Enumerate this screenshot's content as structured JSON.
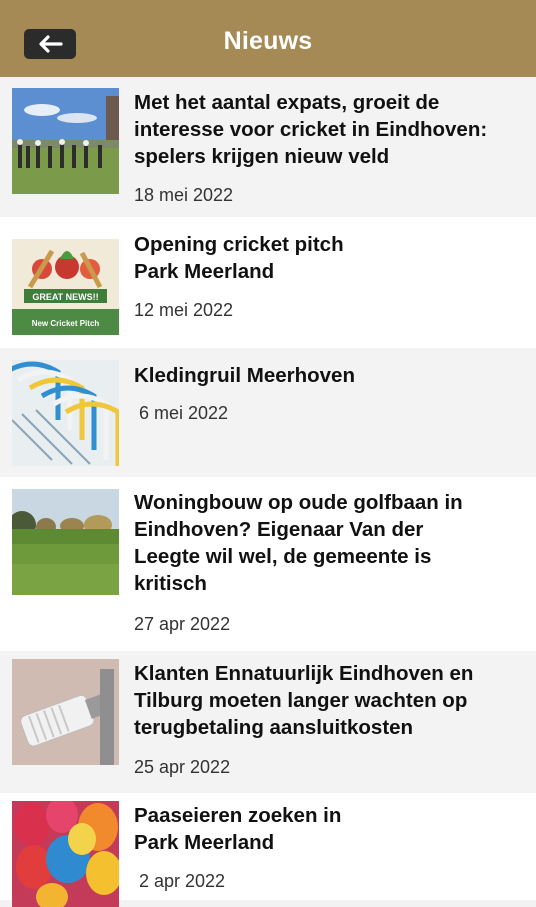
{
  "header": {
    "title": "Nieuws",
    "back_icon": "arrow-left-icon",
    "background": "#a58a55"
  },
  "news": [
    {
      "title_lines": [
        "Met het aantal expats, groeit de",
        "interesse voor cricket in Eindhoven:",
        "spelers krijgen nieuw veld"
      ],
      "date": "18 mei 2022"
    },
    {
      "title_lines": [
        "Opening cricket pitch",
        "Park Meerland"
      ],
      "date": "12 mei 2022",
      "thumb_text": {
        "banner": "GREAT NEWS!!",
        "caption": "New Cricket Pitch"
      }
    },
    {
      "title_lines": [
        "Kledingruil Meerhoven"
      ],
      "date": "6 mei 2022"
    },
    {
      "title_lines": [
        "Woningbouw op oude golfbaan in",
        "Eindhoven? Eigenaar Van der",
        "Leegte wil wel, de gemeente is",
        "kritisch"
      ],
      "date": "27 apr 2022"
    },
    {
      "title_lines": [
        "Klanten Ennatuurlijk Eindhoven en",
        "Tilburg moeten langer wachten op",
        "terugbetaling aansluitkosten"
      ],
      "date": "25 apr 2022"
    },
    {
      "title_lines": [
        "Paaseieren zoeken in",
        "Park Meerland"
      ],
      "date": "2 apr 2022"
    }
  ]
}
